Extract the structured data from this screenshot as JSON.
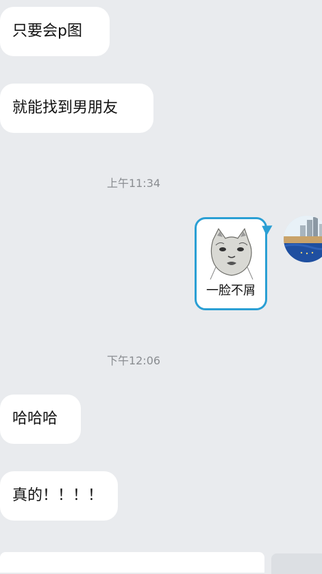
{
  "messages": {
    "m1": "只要会p图",
    "m2": "就能找到男朋友",
    "time1": "上午11:34",
    "sticker_caption": "一脸不屑",
    "time2": "下午12:06",
    "m3": "哈哈哈",
    "m4": "真的！！！！"
  },
  "colors": {
    "background": "#e9ebee",
    "bubble": "#ffffff",
    "sticker_border": "#2a9fd4"
  },
  "icons": {
    "sticker": "cat-meme-sticker",
    "avatar": "user-avatar-cityscape"
  }
}
